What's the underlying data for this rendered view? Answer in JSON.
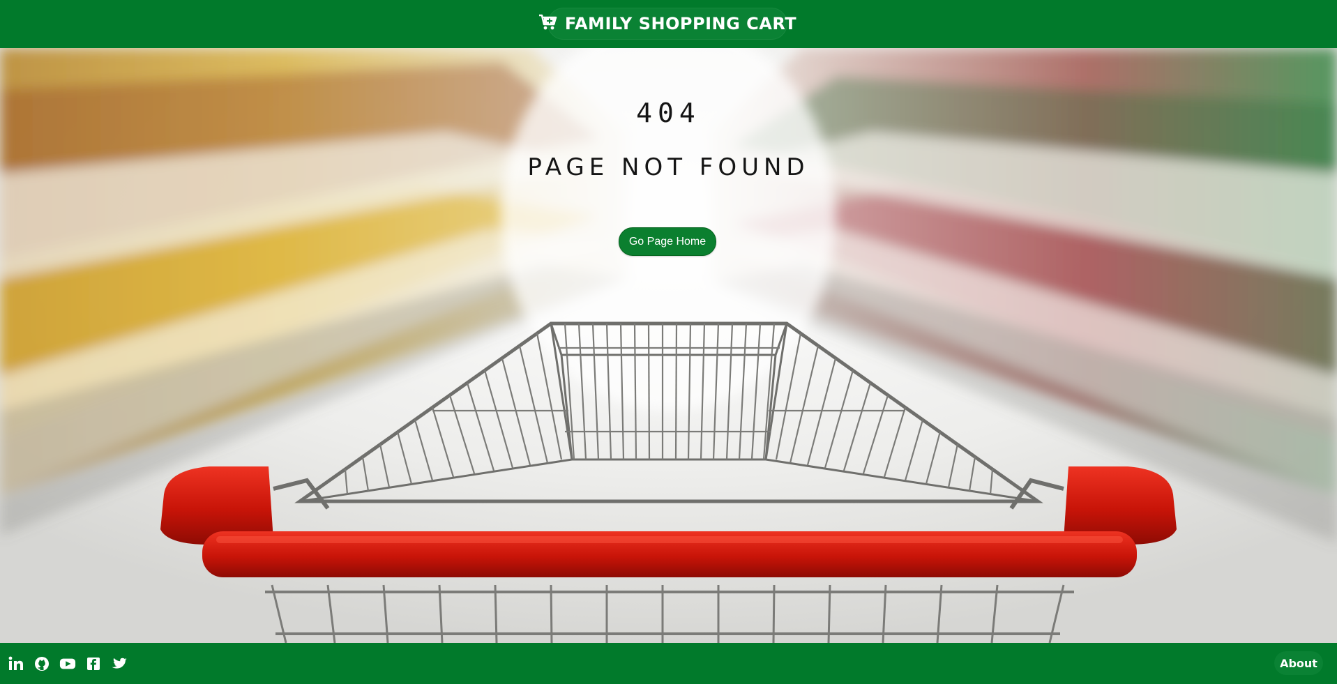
{
  "header": {
    "brand_icon": "cart-icon",
    "brand_title": "FAMILY SHOPPING CART"
  },
  "main": {
    "error_code": "404",
    "error_message": "PAGE NOT FOUND",
    "home_button_label": "Go Page Home",
    "background_image": "shopping-cart-in-supermarket-aisle"
  },
  "footer": {
    "social_links": [
      {
        "icon": "linkedin-icon"
      },
      {
        "icon": "github-icon"
      },
      {
        "icon": "youtube-icon"
      },
      {
        "icon": "facebook-icon"
      },
      {
        "icon": "twitter-icon"
      }
    ],
    "about_label": "About"
  },
  "colors": {
    "brand_green": "#017a2b",
    "button_green": "#0b7f2f",
    "cart_handle_red": "#d81a12",
    "text_dark": "#151515"
  }
}
